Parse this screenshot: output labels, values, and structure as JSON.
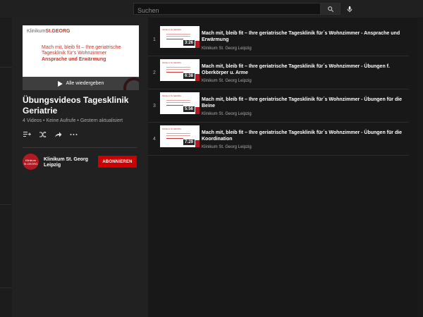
{
  "search": {
    "placeholder": "Suchen"
  },
  "playlist": {
    "thumbnail": {
      "logo_prefix": "Klinikum",
      "logo_brand": "St.GEORG",
      "lines": [
        "Mach mit, bleib fit – Ihre geriatrische",
        "Tagesklinik für's Wohnzimmer"
      ],
      "subtitle": "Ansprache und Erwärmung"
    },
    "play_all_label": "Alle wiedergeben",
    "title": "Übungsvideos Tagesklinik Geriatrie",
    "meta": "4 Videos • Keine Aufrufe • Gestern aktualisiert",
    "channel": {
      "avatar_top": "Klinikum",
      "avatar_bottom": "St.GEORG",
      "name": "Klinikum St. Georg Leipzig"
    },
    "subscribe_label": "ABONNIEREN"
  },
  "videos": [
    {
      "index": "1",
      "duration": "3:26",
      "title": "Mach mit, bleib fit – Ihre geriatrische Tagesklinik für´s Wohnzimmer - Ansprache und Erwärmung",
      "channel": "Klinikum St. Georg Leipzig",
      "thumb_label": "Klinikum St.GEORG"
    },
    {
      "index": "2",
      "duration": "6:38",
      "title": "Mach mit, bleib fit – Ihre geriatrische Tagesklinik für´s Wohnzimmer - Übungen f. Oberkörper u. Arme",
      "channel": "Klinikum St. Georg Leipzig",
      "thumb_label": "Klinikum St.GEORG"
    },
    {
      "index": "3",
      "duration": "5:56",
      "title": "Mach mit, bleib fit – Ihre geriatrische Tagesklinik für´s Wohnzimmer - Übungen für die Beine",
      "channel": "Klinikum St. Georg Leipzig",
      "thumb_label": "Klinikum St.GEORG"
    },
    {
      "index": "4",
      "duration": "7:29",
      "title": "Mach mit, bleib fit – Ihre geriatrische Tagesklinik für´s Wohnzimmer - Übungen für die Koordination",
      "channel": "Klinikum St. Georg Leipzig",
      "thumb_label": "Klinikum St.GEORG"
    }
  ],
  "icons": {
    "search": "search-icon",
    "mic": "mic-icon",
    "play": "play-icon",
    "add_to_queue": "add-to-queue-icon",
    "shuffle": "shuffle-icon",
    "share": "share-icon",
    "more": "more-icon"
  },
  "colors": {
    "accent": "#cc0000",
    "brand_red": "#b21a22",
    "background": "#181818",
    "panel": "#212121"
  }
}
